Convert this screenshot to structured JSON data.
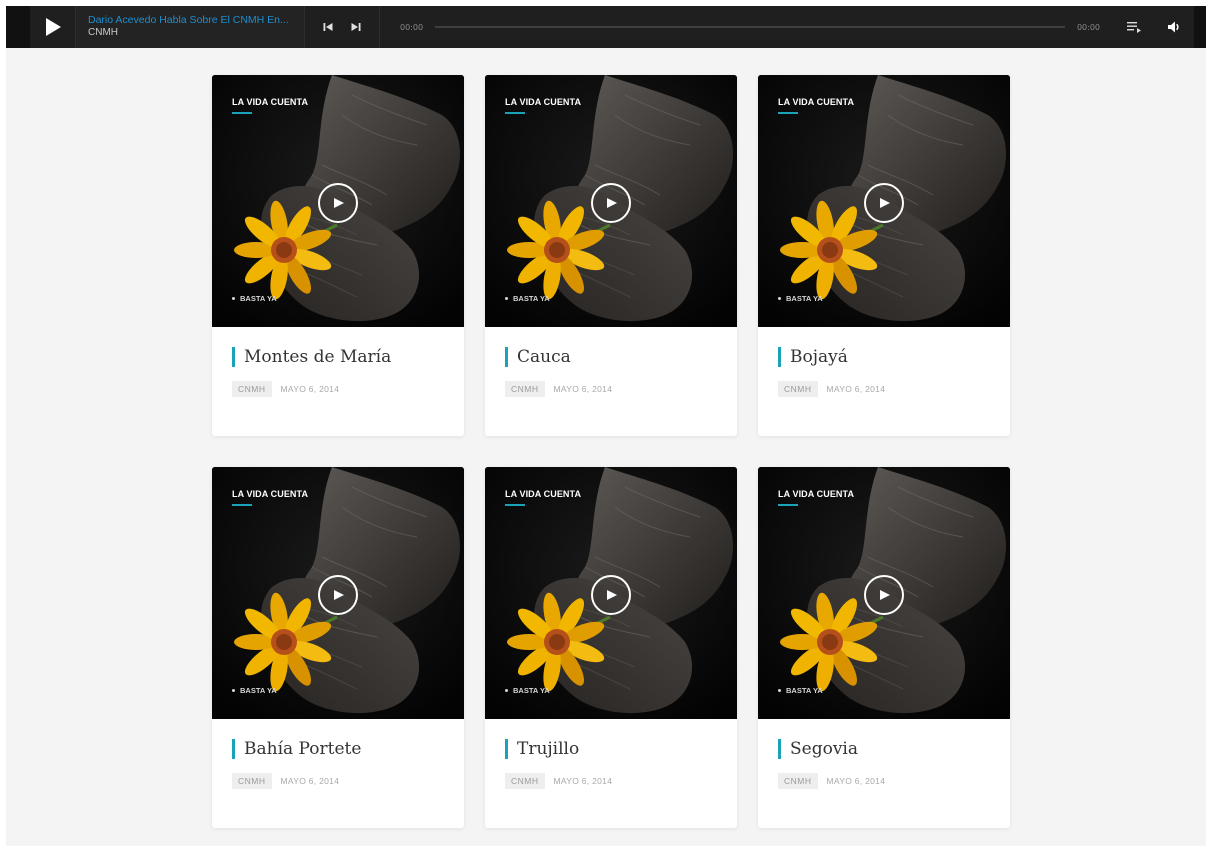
{
  "player": {
    "track_title": "Dario Acevedo Habla Sobre El CNMH En...",
    "track_artist": "CNMH",
    "current_time": "00:00",
    "total_time": "00:00",
    "progress": 0
  },
  "colors": {
    "accent": "#1aa3b8",
    "player_link": "#1d8fd0",
    "player_bg": "#1f1f1f"
  },
  "icons": {
    "play": "play-icon",
    "previous": "skip-previous-icon",
    "next": "skip-next-icon",
    "playlist": "playlist-icon",
    "volume": "volume-icon"
  },
  "cards": [
    {
      "category": "LA VIDA CUENTA",
      "tag": "BASTA YA",
      "title": "Montes de María",
      "author": "CNMH",
      "date": "MAYO 6, 2014"
    },
    {
      "category": "LA VIDA CUENTA",
      "tag": "BASTA YA",
      "title": "Cauca",
      "author": "CNMH",
      "date": "MAYO 6, 2014"
    },
    {
      "category": "LA VIDA CUENTA",
      "tag": "BASTA YA",
      "title": "Bojayá",
      "author": "CNMH",
      "date": "MAYO 6, 2014"
    },
    {
      "category": "LA VIDA CUENTA",
      "tag": "BASTA YA",
      "title": "Bahía Portete",
      "author": "CNMH",
      "date": "MAYO 6, 2014"
    },
    {
      "category": "LA VIDA CUENTA",
      "tag": "BASTA YA",
      "title": "Trujillo",
      "author": "CNMH",
      "date": "MAYO 6, 2014"
    },
    {
      "category": "LA VIDA CUENTA",
      "tag": "BASTA YA",
      "title": "Segovia",
      "author": "CNMH",
      "date": "MAYO 6, 2014"
    }
  ]
}
